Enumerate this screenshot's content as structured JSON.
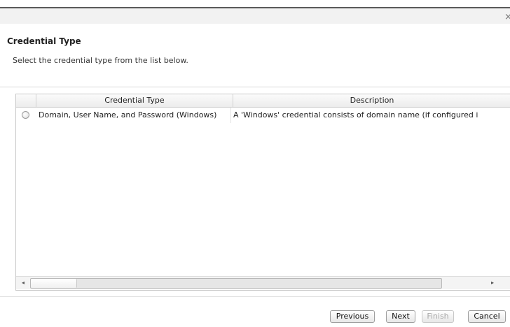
{
  "window": {
    "close_glyph": "×"
  },
  "header": {
    "title": "Credential Type",
    "subtitle": "Select the credential type from the list below."
  },
  "grid": {
    "columns": [
      "Credential Type",
      "Description"
    ],
    "rows": [
      {
        "selected": false,
        "type": "Domain, User Name, and Password (Windows)",
        "description": "A 'Windows' credential consists of domain name (if configured i"
      }
    ],
    "scroll_left": "◂",
    "scroll_right": "▸"
  },
  "footer": {
    "previous": "Previous",
    "next": "Next",
    "finish": "Finish",
    "cancel": "Cancel"
  }
}
